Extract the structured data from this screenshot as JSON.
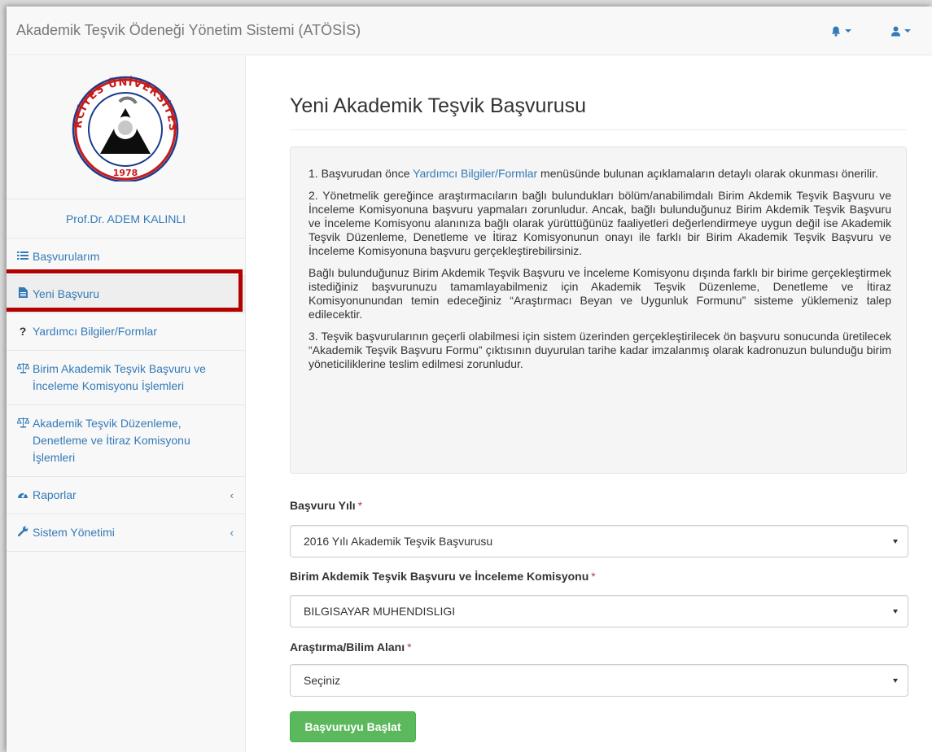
{
  "app": {
    "title": "Akademik Teşvik Ödeneği Yönetim Sistemi (ATÖSİS)"
  },
  "header_icons": {
    "notifications": "bell-icon",
    "user_menu": "user-icon"
  },
  "logo": {
    "top_text": "ERCİYES ÜNİVERSİTESİ",
    "year": "1978"
  },
  "user": {
    "name": "Prof.Dr. ADEM KALINLI"
  },
  "sidebar": {
    "items": [
      {
        "label": "Başvurularım",
        "icon": "list-icon"
      },
      {
        "label": "Yeni Başvuru",
        "icon": "file-icon",
        "active": true
      },
      {
        "label": "Yardımcı Bilgiler/Formlar",
        "icon": "question-icon"
      },
      {
        "label": "Birim Akademik Teşvik Başvuru ve İnceleme Komisyonu İşlemleri",
        "icon": "balance-scale-icon"
      },
      {
        "label": "Akademik Teşvik Düzenleme, Denetleme ve İtiraz Komisyonu İşlemleri",
        "icon": "balance-scale-icon"
      },
      {
        "label": "Raporlar",
        "icon": "dashboard-icon",
        "expand_arrow": "‹"
      },
      {
        "label": "Sistem Yönetimi",
        "icon": "wrench-icon",
        "expand_arrow": "‹"
      }
    ]
  },
  "page": {
    "title": "Yeni Akademik Teşvik Başvurusu",
    "info": {
      "p1_before": "1. Başvurudan önce ",
      "p1_link": "Yardımcı Bilgiler/Formlar",
      "p1_after": " menüsünde bulunan açıklamaların detaylı olarak okunması önerilir.",
      "p2": "2. Yönetmelik gereğince araştırmacıların bağlı bulundukları bölüm/anabilimdalı Birim Akdemik Teşvik Başvuru ve İnceleme Komisyonuna başvuru yapmaları zorunludur. Ancak, bağlı bulunduğunuz Birim Akdemik Teşvik Başvuru ve İnceleme Komisyonu alanınıza bağlı olarak yürüttüğünüz faaliyetleri değerlendirmeye uygun değil ise Akademik Teşvik Düzenleme, Denetleme ve İtiraz Komisyonunun onayı ile farklı bir Birim Akademik Teşvik Başvuru ve İnceleme Komisyonuna başvuru gerçekleştirebilirsiniz.",
      "p3": "Bağlı bulunduğunuz Birim Akdemik Teşvik Başvuru ve İnceleme Komisyonu dışında farklı bir birime gerçekleştirmek istediğiniz başvurunuzu tamamlayabilmeniz için Akademik Teşvik Düzenleme, Denetleme ve İtiraz Komisyonunundan temin edeceğiniz “Araştırmacı Beyan ve Uygunluk Formunu” sisteme yüklemeniz talep edilecektir.",
      "p4": "3. Teşvik başvurularının geçerli olabilmesi için sistem üzerinden gerçekleştirilecek ön başvuru sonucunda üretilecek “Akademik Teşvik Başvuru Formu” çıktısının duyurulan tarihe kadar imzalanmış olarak kadronuzun bulunduğu birim yöneticiliklerine teslim edilmesi zorunludur."
    },
    "form": {
      "year_label": "Başvuru Yılı",
      "year_value": "2016 Yılı Akademik Teşvik Başvurusu",
      "commission_label": "Birim Akdemik Teşvik Başvuru ve İnceleme Komisyonu",
      "commission_value": "BILGISAYAR MUHENDISLIGI",
      "field_label": "Araştırma/Bilim Alanı",
      "field_value": "Seçiniz",
      "required_mark": "*",
      "submit_label": "Başvuruyu Başlat"
    }
  },
  "colors": {
    "link": "#337ab7",
    "success": "#5cb85c",
    "highlight": "#b50000",
    "required": "#a94442"
  }
}
